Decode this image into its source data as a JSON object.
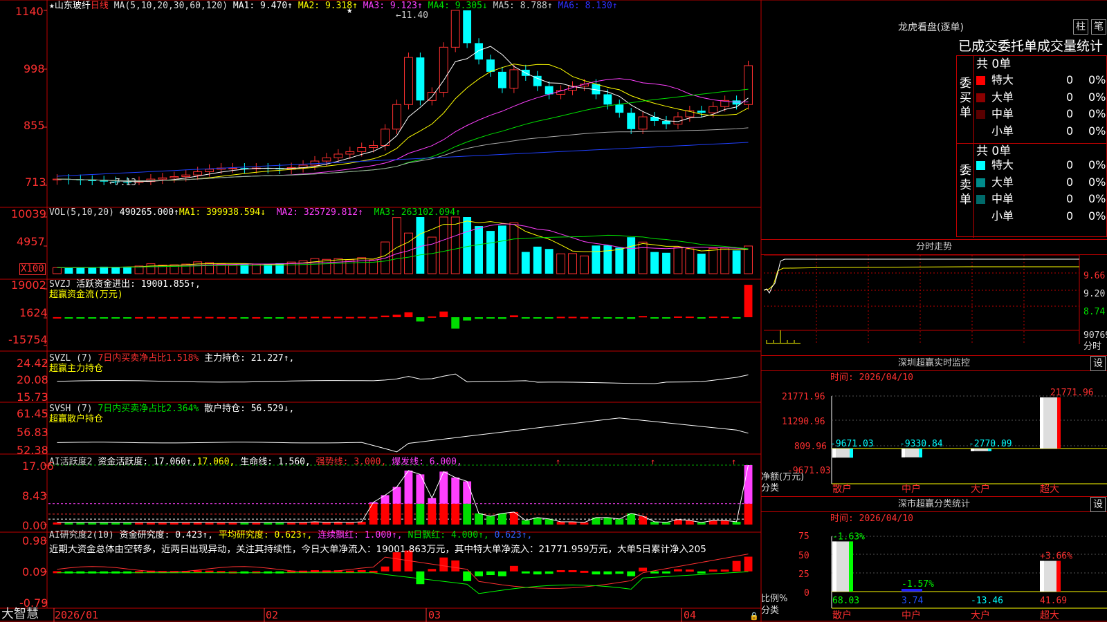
{
  "app": {
    "brand": "大智慧"
  },
  "kline": {
    "title_star": "★",
    "stock_name": "山东玻纤",
    "period": "日线",
    "ma_params": "MA(5,10,20,30,60,120)",
    "ma1": "MA1: 9.470↑",
    "ma2": "MA2: 9.318↑",
    "ma3": "MA3: 9.123↑",
    "ma4": "MA4: 9.305↓",
    "ma5": "MA5: 8.788↑",
    "ma6": "MA6: 8.130↑",
    "high_label": "11.40",
    "low_label": "←7.13",
    "star_mark": "★",
    "axis": [
      "1140",
      "998",
      "855",
      "713"
    ]
  },
  "vol": {
    "params": "VOL(5,10,20)",
    "value": "490265.000↑",
    "ma1": "MA1: 399938.594↓",
    "ma2": "MA2: 325729.812↑",
    "ma3": "MA3: 263102.094↑",
    "axis": [
      "10039",
      "4957"
    ],
    "unit": "X100"
  },
  "svzj": {
    "name": "SVZJ",
    "text": "活跃资金进出: 19001.855↑,",
    "sub": "超赢资金流(万元)",
    "axis": [
      "19002",
      "1624",
      "-15754"
    ]
  },
  "svzl": {
    "name": "SVZL (7)",
    "pct": "7日内买卖净占比1.518%",
    "hold": "主力持仓: 21.227↑,",
    "sub": "超赢主力持仓",
    "axis": [
      "24.42",
      "20.08",
      "15.73"
    ]
  },
  "svsh": {
    "name": "SVSH (7)",
    "pct": "7日内买卖净占比2.364%",
    "hold": "散户持仓: 56.529↓,",
    "sub": "超赢散户持仓",
    "axis": [
      "61.45",
      "56.83",
      "52.38"
    ]
  },
  "ai2": {
    "name": "AI活跃度2",
    "act": "资金活跃度: 17.060↑,",
    "act2": "17.060,",
    "life": "生命线: 1.560,",
    "strong": "强势线: 3.000,",
    "burst": "爆发线: 6.000,",
    "axis": [
      "17.06",
      "8.43",
      "0.00"
    ]
  },
  "ai3": {
    "name": "AI研究度2(10)",
    "study": "资金研究度: 0.423↑,",
    "avg": "平均研究度: 0.623↑,",
    "cont": "连续飘红: 1.000↑,",
    "nred": "N日飘红: 4.000↑,",
    "last": "0.623↑,",
    "comment": "近期大资金总体由空转多，近两日出现异动，关注其持续性，今日大单净流入：19001.863万元，其中特大单净流入：21771.959万元，大单5日累计净入205",
    "axis": [
      "0.98",
      "0.09",
      "-0.79"
    ]
  },
  "dates": [
    "2026/01",
    "02",
    "03",
    "04"
  ],
  "lhb": {
    "title": "龙虎看盘(逐单)",
    "tab1": "柱",
    "tab2": "笔",
    "subtitle": "已成交委托单成交量统计",
    "buy_label": "委买单",
    "sell_label": "委卖单",
    "buy_total": "共 0单",
    "sell_total": "共 0单",
    "buy_rows": [
      {
        "name": "特大",
        "count": "0",
        "pct": "0%",
        "color": "#ff0000"
      },
      {
        "name": "大单",
        "count": "0",
        "pct": "0%",
        "color": "#8b0000"
      },
      {
        "name": "中单",
        "count": "0",
        "pct": "0%",
        "color": "#5a0000"
      },
      {
        "name": "小单",
        "count": "0",
        "pct": "0%",
        "color": "#000000"
      }
    ],
    "sell_rows": [
      {
        "name": "特大",
        "count": "0",
        "pct": "0%",
        "color": "#00ffff"
      },
      {
        "name": "大单",
        "count": "0",
        "pct": "0%",
        "color": "#008b8b"
      },
      {
        "name": "中单",
        "count": "0",
        "pct": "0%",
        "color": "#006a6a"
      },
      {
        "name": "小单",
        "count": "0",
        "pct": "0%",
        "color": "#000000"
      }
    ]
  },
  "fenshi": {
    "title": "分时走势",
    "axis": [
      "9.66",
      "9.20",
      "8.74"
    ],
    "vol": "90769",
    "vol_label": "分时"
  },
  "monitor": {
    "title": "深圳超赢实时监控",
    "gear": "设",
    "time": "时间: 2026/04/10",
    "axis": [
      "21771.96",
      "11290.96",
      "809.96",
      "-9671.03"
    ],
    "ylab1": "净额(万元)",
    "ylab2": "分类",
    "cats": [
      "散户",
      "中户",
      "大户",
      "超大"
    ],
    "values": [
      -9671.03,
      -9330.84,
      -2770.09,
      21771.96
    ],
    "labels": [
      "-9671.03",
      "-9330.84",
      "-2770.09",
      "21771.96"
    ]
  },
  "classify": {
    "title": "深市超赢分类统计",
    "gear": "设",
    "time": "时间: 2026/04/10",
    "axis": [
      "75",
      "50",
      "25",
      "0"
    ],
    "ylab1": "比例%",
    "ylab2": "分类",
    "cats": [
      "散户",
      "中户",
      "大户",
      "超大"
    ],
    "ratios": [
      68.03,
      3.74,
      -13.46,
      41.69
    ],
    "ratio_labels": [
      "68.03",
      "3.74",
      "-13.46",
      "41.69"
    ],
    "changes": [
      "-1.63%",
      "-1.57%",
      "",
      "+3.66%"
    ]
  },
  "chart_data": [
    {
      "type": "candlestick",
      "title": "山东玻纤 日线",
      "ylim": [
        7.13,
        11.4
      ],
      "ma": {
        "MA1": 9.47,
        "MA2": 9.318,
        "MA3": 9.123,
        "MA4": 9.305,
        "MA5": 8.788,
        "MA6": 8.13
      },
      "high": 11.4,
      "low": 7.13
    },
    {
      "type": "bar",
      "title": "VOL(5,10,20)",
      "last": 490265.0,
      "ylim": [
        0,
        10039
      ]
    },
    {
      "type": "bar",
      "title": "SVZJ 超赢资金流(万元)",
      "last": 19001.855,
      "ylim": [
        -15754,
        19002
      ]
    },
    {
      "type": "line",
      "title": "SVZL 超赢主力持仓",
      "last": 21.227,
      "ylim": [
        15.73,
        24.42
      ]
    },
    {
      "type": "line",
      "title": "SVSH 超赢散户持仓",
      "last": 56.529,
      "ylim": [
        52.38,
        61.45
      ]
    },
    {
      "type": "bar",
      "title": "AI活跃度2",
      "last": 17.06,
      "ylim": [
        0,
        17.06
      ]
    },
    {
      "type": "bar",
      "title": "AI研究度2(10)",
      "last": 0.423,
      "ylim": [
        -0.79,
        0.98
      ]
    },
    {
      "type": "bar",
      "title": "深圳超赢实时监控",
      "categories": [
        "散户",
        "中户",
        "大户",
        "超大"
      ],
      "values": [
        -9671.03,
        -9330.84,
        -2770.09,
        21771.96
      ]
    },
    {
      "type": "bar",
      "title": "深市超赢分类统计",
      "categories": [
        "散户",
        "中户",
        "大户",
        "超大"
      ],
      "values": [
        68.03,
        3.74,
        -13.46,
        41.69
      ]
    }
  ]
}
